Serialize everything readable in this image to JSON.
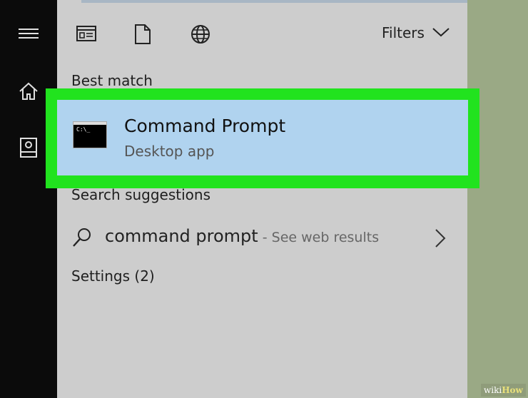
{
  "toolbar": {
    "filters_label": "Filters",
    "icons": [
      "documents-icon",
      "apps-icon",
      "web-icon"
    ]
  },
  "rail": {
    "icons": [
      "hamburger-menu-icon",
      "home-icon",
      "user-documents-icon"
    ]
  },
  "sections": {
    "best_match": "Best match",
    "search_suggestions": "Search suggestions",
    "settings": "Settings (2)"
  },
  "best_result": {
    "title": "Command Prompt",
    "subtitle": "Desktop app",
    "icon_text": "C:\\_"
  },
  "suggestion": {
    "query": "command prompt",
    "web_hint": " - See web results"
  },
  "watermark": {
    "wiki": "wiki",
    "how": "How"
  },
  "colors": {
    "rail": "#0b0b0b",
    "panel": "#cdcdcd",
    "selected": "#b0d3ef",
    "highlight": "#21e31e",
    "desktop": "#9aa985"
  }
}
